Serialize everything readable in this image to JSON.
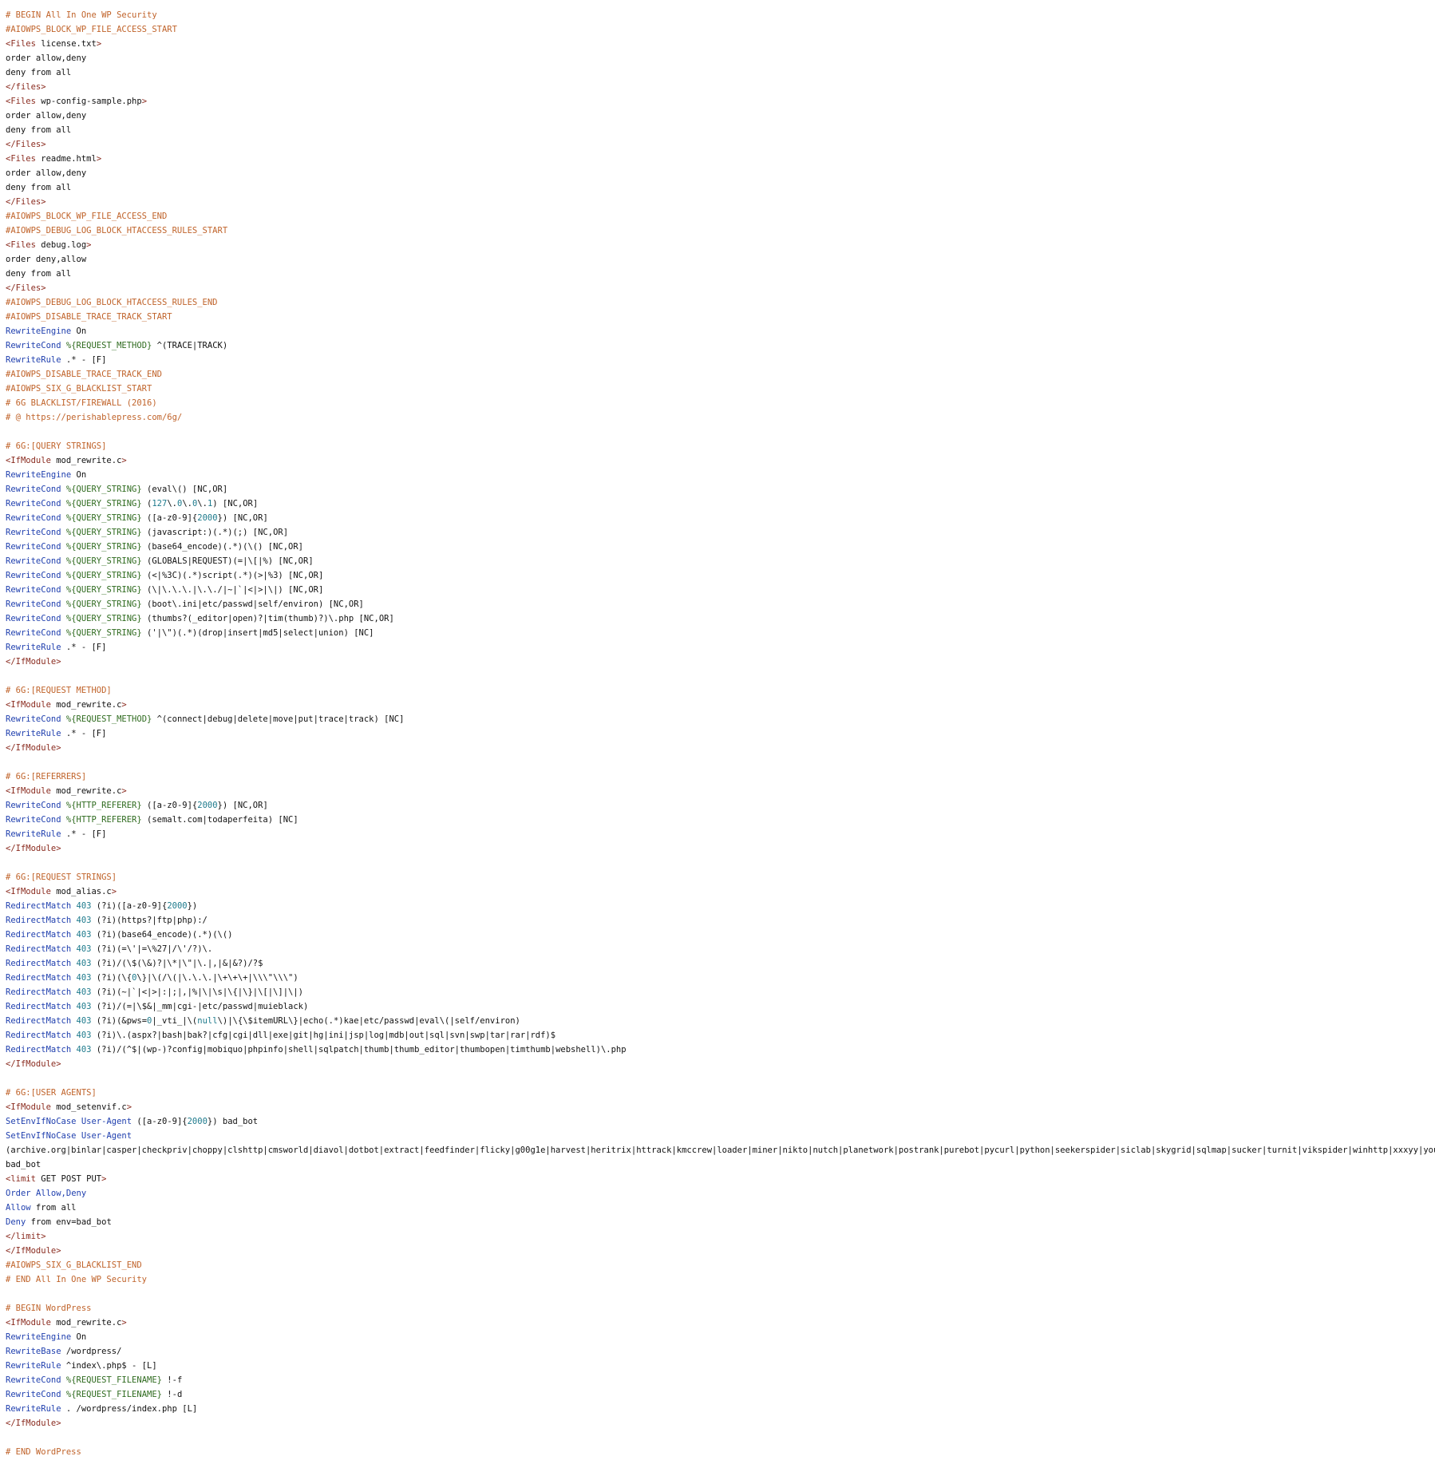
{
  "colors": {
    "background": "#ffffff",
    "comment": "#c0632a",
    "tag": "#8a2b1f",
    "directive": "#1f3fae",
    "variable": "#2f6b1f",
    "number": "#1d7a8c",
    "text": "#111111"
  },
  "lines": [
    [
      {
        "t": "comment",
        "s": "# BEGIN All In One WP Security"
      }
    ],
    [
      {
        "t": "comment",
        "s": "#AIOWPS_BLOCK_WP_FILE_ACCESS_START"
      }
    ],
    [
      {
        "t": "tag",
        "s": "<Files "
      },
      {
        "t": "text",
        "s": "license.txt"
      },
      {
        "t": "tag",
        "s": ">"
      }
    ],
    [
      {
        "t": "text",
        "s": "order allow,deny"
      }
    ],
    [
      {
        "t": "text",
        "s": "deny from all"
      }
    ],
    [
      {
        "t": "tag",
        "s": "</files>"
      }
    ],
    [
      {
        "t": "tag",
        "s": "<Files "
      },
      {
        "t": "text",
        "s": "wp-config-sample.php"
      },
      {
        "t": "tag",
        "s": ">"
      }
    ],
    [
      {
        "t": "text",
        "s": "order allow,deny"
      }
    ],
    [
      {
        "t": "text",
        "s": "deny from all"
      }
    ],
    [
      {
        "t": "tag",
        "s": "</Files>"
      }
    ],
    [
      {
        "t": "tag",
        "s": "<Files "
      },
      {
        "t": "text",
        "s": "readme.html"
      },
      {
        "t": "tag",
        "s": ">"
      }
    ],
    [
      {
        "t": "text",
        "s": "order allow,deny"
      }
    ],
    [
      {
        "t": "text",
        "s": "deny from all"
      }
    ],
    [
      {
        "t": "tag",
        "s": "</Files>"
      }
    ],
    [
      {
        "t": "comment",
        "s": "#AIOWPS_BLOCK_WP_FILE_ACCESS_END"
      }
    ],
    [
      {
        "t": "comment",
        "s": "#AIOWPS_DEBUG_LOG_BLOCK_HTACCESS_RULES_START"
      }
    ],
    [
      {
        "t": "tag",
        "s": "<Files "
      },
      {
        "t": "text",
        "s": "debug.log"
      },
      {
        "t": "tag",
        "s": ">"
      }
    ],
    [
      {
        "t": "text",
        "s": "order deny,allow"
      }
    ],
    [
      {
        "t": "text",
        "s": "deny from all"
      }
    ],
    [
      {
        "t": "tag",
        "s": "</Files>"
      }
    ],
    [
      {
        "t": "comment",
        "s": "#AIOWPS_DEBUG_LOG_BLOCK_HTACCESS_RULES_END"
      }
    ],
    [
      {
        "t": "comment",
        "s": "#AIOWPS_DISABLE_TRACE_TRACK_START"
      }
    ],
    [
      {
        "t": "directive",
        "s": "RewriteEngine"
      },
      {
        "t": "text",
        "s": " On"
      }
    ],
    [
      {
        "t": "directive",
        "s": "RewriteCond"
      },
      {
        "t": "text",
        "s": " "
      },
      {
        "t": "var",
        "s": "%{REQUEST_METHOD}"
      },
      {
        "t": "text",
        "s": " ^(TRACE|TRACK)"
      }
    ],
    [
      {
        "t": "directive",
        "s": "RewriteRule"
      },
      {
        "t": "text",
        "s": " .* - [F]"
      }
    ],
    [
      {
        "t": "comment",
        "s": "#AIOWPS_DISABLE_TRACE_TRACK_END"
      }
    ],
    [
      {
        "t": "comment",
        "s": "#AIOWPS_SIX_G_BLACKLIST_START"
      }
    ],
    [
      {
        "t": "comment",
        "s": "# 6G BLACKLIST/FIREWALL (2016)"
      }
    ],
    [
      {
        "t": "comment",
        "s": "# @ https://perishablepress.com/6g/"
      }
    ],
    [],
    [
      {
        "t": "comment",
        "s": "# 6G:[QUERY STRINGS]"
      }
    ],
    [
      {
        "t": "tag",
        "s": "<IfModule "
      },
      {
        "t": "text",
        "s": "mod_rewrite.c"
      },
      {
        "t": "tag",
        "s": ">"
      }
    ],
    [
      {
        "t": "directive",
        "s": "RewriteEngine"
      },
      {
        "t": "text",
        "s": " On"
      }
    ],
    [
      {
        "t": "directive",
        "s": "RewriteCond"
      },
      {
        "t": "text",
        "s": " "
      },
      {
        "t": "var",
        "s": "%{QUERY_STRING}"
      },
      {
        "t": "text",
        "s": " (eval\\() [NC,OR]"
      }
    ],
    [
      {
        "t": "directive",
        "s": "RewriteCond"
      },
      {
        "t": "text",
        "s": " "
      },
      {
        "t": "var",
        "s": "%{QUERY_STRING}"
      },
      {
        "t": "text",
        "s": " ("
      },
      {
        "t": "num",
        "s": "127"
      },
      {
        "t": "text",
        "s": "\\."
      },
      {
        "t": "num",
        "s": "0"
      },
      {
        "t": "text",
        "s": "\\."
      },
      {
        "t": "num",
        "s": "0"
      },
      {
        "t": "text",
        "s": "\\."
      },
      {
        "t": "num",
        "s": "1"
      },
      {
        "t": "text",
        "s": ") [NC,OR]"
      }
    ],
    [
      {
        "t": "directive",
        "s": "RewriteCond"
      },
      {
        "t": "text",
        "s": " "
      },
      {
        "t": "var",
        "s": "%{QUERY_STRING}"
      },
      {
        "t": "text",
        "s": " ([a-z0-9]{"
      },
      {
        "t": "num",
        "s": "2000"
      },
      {
        "t": "text",
        "s": "}) [NC,OR]"
      }
    ],
    [
      {
        "t": "directive",
        "s": "RewriteCond"
      },
      {
        "t": "text",
        "s": " "
      },
      {
        "t": "var",
        "s": "%{QUERY_STRING}"
      },
      {
        "t": "text",
        "s": " (javascript:)(.*)(;) [NC,OR]"
      }
    ],
    [
      {
        "t": "directive",
        "s": "RewriteCond"
      },
      {
        "t": "text",
        "s": " "
      },
      {
        "t": "var",
        "s": "%{QUERY_STRING}"
      },
      {
        "t": "text",
        "s": " (base64_encode)(.*)(\\() [NC,OR]"
      }
    ],
    [
      {
        "t": "directive",
        "s": "RewriteCond"
      },
      {
        "t": "text",
        "s": " "
      },
      {
        "t": "var",
        "s": "%{QUERY_STRING}"
      },
      {
        "t": "text",
        "s": " (GLOBALS|REQUEST)(=|\\[|%) [NC,OR]"
      }
    ],
    [
      {
        "t": "directive",
        "s": "RewriteCond"
      },
      {
        "t": "text",
        "s": " "
      },
      {
        "t": "var",
        "s": "%{QUERY_STRING}"
      },
      {
        "t": "text",
        "s": " (<|%3C)(.*)script(.*)(>|%3) [NC,OR]"
      }
    ],
    [
      {
        "t": "directive",
        "s": "RewriteCond"
      },
      {
        "t": "text",
        "s": " "
      },
      {
        "t": "var",
        "s": "%{QUERY_STRING}"
      },
      {
        "t": "text",
        "s": " (\\|\\.\\.\\.|\\.\\./|~|`|<|>|\\|) [NC,OR]"
      }
    ],
    [
      {
        "t": "directive",
        "s": "RewriteCond"
      },
      {
        "t": "text",
        "s": " "
      },
      {
        "t": "var",
        "s": "%{QUERY_STRING}"
      },
      {
        "t": "text",
        "s": " (boot\\.ini|etc/passwd|self/environ) [NC,OR]"
      }
    ],
    [
      {
        "t": "directive",
        "s": "RewriteCond"
      },
      {
        "t": "text",
        "s": " "
      },
      {
        "t": "var",
        "s": "%{QUERY_STRING}"
      },
      {
        "t": "text",
        "s": " (thumbs?(_editor|open)?|tim(thumb)?)\\.php [NC,OR]"
      }
    ],
    [
      {
        "t": "directive",
        "s": "RewriteCond"
      },
      {
        "t": "text",
        "s": " "
      },
      {
        "t": "var",
        "s": "%{QUERY_STRING}"
      },
      {
        "t": "text",
        "s": " ('|\\\")(.*)(drop|insert|md5|select|union) [NC]"
      }
    ],
    [
      {
        "t": "directive",
        "s": "RewriteRule"
      },
      {
        "t": "text",
        "s": " .* - [F]"
      }
    ],
    [
      {
        "t": "tag",
        "s": "</IfModule>"
      }
    ],
    [],
    [
      {
        "t": "comment",
        "s": "# 6G:[REQUEST METHOD]"
      }
    ],
    [
      {
        "t": "tag",
        "s": "<IfModule "
      },
      {
        "t": "text",
        "s": "mod_rewrite.c"
      },
      {
        "t": "tag",
        "s": ">"
      }
    ],
    [
      {
        "t": "directive",
        "s": "RewriteCond"
      },
      {
        "t": "text",
        "s": " "
      },
      {
        "t": "var",
        "s": "%{REQUEST_METHOD}"
      },
      {
        "t": "text",
        "s": " ^(connect|debug|delete|move|put|trace|track) [NC]"
      }
    ],
    [
      {
        "t": "directive",
        "s": "RewriteRule"
      },
      {
        "t": "text",
        "s": " .* - [F]"
      }
    ],
    [
      {
        "t": "tag",
        "s": "</IfModule>"
      }
    ],
    [],
    [
      {
        "t": "comment",
        "s": "# 6G:[REFERRERS]"
      }
    ],
    [
      {
        "t": "tag",
        "s": "<IfModule "
      },
      {
        "t": "text",
        "s": "mod_rewrite.c"
      },
      {
        "t": "tag",
        "s": ">"
      }
    ],
    [
      {
        "t": "directive",
        "s": "RewriteCond"
      },
      {
        "t": "text",
        "s": " "
      },
      {
        "t": "var",
        "s": "%{HTTP_REFERER}"
      },
      {
        "t": "text",
        "s": " ([a-z0-9]{"
      },
      {
        "t": "num",
        "s": "2000"
      },
      {
        "t": "text",
        "s": "}) [NC,OR]"
      }
    ],
    [
      {
        "t": "directive",
        "s": "RewriteCond"
      },
      {
        "t": "text",
        "s": " "
      },
      {
        "t": "var",
        "s": "%{HTTP_REFERER}"
      },
      {
        "t": "text",
        "s": " (semalt.com|todaperfeita) [NC]"
      }
    ],
    [
      {
        "t": "directive",
        "s": "RewriteRule"
      },
      {
        "t": "text",
        "s": " .* - [F]"
      }
    ],
    [
      {
        "t": "tag",
        "s": "</IfModule>"
      }
    ],
    [],
    [
      {
        "t": "comment",
        "s": "# 6G:[REQUEST STRINGS]"
      }
    ],
    [
      {
        "t": "tag",
        "s": "<IfModule "
      },
      {
        "t": "text",
        "s": "mod_alias.c"
      },
      {
        "t": "tag",
        "s": ">"
      }
    ],
    [
      {
        "t": "directive",
        "s": "RedirectMatch"
      },
      {
        "t": "text",
        "s": " "
      },
      {
        "t": "num",
        "s": "403"
      },
      {
        "t": "text",
        "s": " (?i)([a-z0-9]{"
      },
      {
        "t": "num",
        "s": "2000"
      },
      {
        "t": "text",
        "s": "})"
      }
    ],
    [
      {
        "t": "directive",
        "s": "RedirectMatch"
      },
      {
        "t": "text",
        "s": " "
      },
      {
        "t": "num",
        "s": "403"
      },
      {
        "t": "text",
        "s": " (?i)(https?|ftp|php):/"
      }
    ],
    [
      {
        "t": "directive",
        "s": "RedirectMatch"
      },
      {
        "t": "text",
        "s": " "
      },
      {
        "t": "num",
        "s": "403"
      },
      {
        "t": "text",
        "s": " (?i)(base64_encode)(.*)(\\()"
      }
    ],
    [
      {
        "t": "directive",
        "s": "RedirectMatch"
      },
      {
        "t": "text",
        "s": " "
      },
      {
        "t": "num",
        "s": "403"
      },
      {
        "t": "text",
        "s": " (?i)(=\\'|=\\%27|/\\'/?)\\."
      }
    ],
    [
      {
        "t": "directive",
        "s": "RedirectMatch"
      },
      {
        "t": "text",
        "s": " "
      },
      {
        "t": "num",
        "s": "403"
      },
      {
        "t": "text",
        "s": " (?i)/(\\$(\\&)?|\\*|\\\"|\\.|,|&|&?)/?$"
      }
    ],
    [
      {
        "t": "directive",
        "s": "RedirectMatch"
      },
      {
        "t": "text",
        "s": " "
      },
      {
        "t": "num",
        "s": "403"
      },
      {
        "t": "text",
        "s": " (?i)(\\{"
      },
      {
        "t": "num",
        "s": "0"
      },
      {
        "t": "text",
        "s": "\\}|\\(/\\(|\\.\\.\\.|\\+\\+\\+|\\\\\\\"\\\\\\\")"
      }
    ],
    [
      {
        "t": "directive",
        "s": "RedirectMatch"
      },
      {
        "t": "text",
        "s": " "
      },
      {
        "t": "num",
        "s": "403"
      },
      {
        "t": "text",
        "s": " (?i)(~|`|<|>|:|;|,|%|\\|\\s|\\{|\\}|\\[|\\]|\\|)"
      }
    ],
    [
      {
        "t": "directive",
        "s": "RedirectMatch"
      },
      {
        "t": "text",
        "s": " "
      },
      {
        "t": "num",
        "s": "403"
      },
      {
        "t": "text",
        "s": " (?i)/(=|\\$&|_mm|cgi-|etc/passwd|muieblack)"
      }
    ],
    [
      {
        "t": "directive",
        "s": "RedirectMatch"
      },
      {
        "t": "text",
        "s": " "
      },
      {
        "t": "num",
        "s": "403"
      },
      {
        "t": "text",
        "s": " (?i)(&pws="
      },
      {
        "t": "num",
        "s": "0"
      },
      {
        "t": "text",
        "s": "|_vti_|\\("
      },
      {
        "t": "num",
        "s": "null"
      },
      {
        "t": "text",
        "s": "\\)|\\{\\$itemURL\\}|echo(.*)kae|etc/passwd|eval\\(|self/environ)"
      }
    ],
    [
      {
        "t": "directive",
        "s": "RedirectMatch"
      },
      {
        "t": "text",
        "s": " "
      },
      {
        "t": "num",
        "s": "403"
      },
      {
        "t": "text",
        "s": " (?i)\\.(aspx?|bash|bak?|cfg|cgi|dll|exe|git|hg|ini|jsp|log|mdb|out|sql|svn|swp|tar|rar|rdf)$"
      }
    ],
    [
      {
        "t": "directive",
        "s": "RedirectMatch"
      },
      {
        "t": "text",
        "s": " "
      },
      {
        "t": "num",
        "s": "403"
      },
      {
        "t": "text",
        "s": " (?i)/(^$|(wp-)?config|mobiquo|phpinfo|shell|sqlpatch|thumb|thumb_editor|thumbopen|timthumb|webshell)\\.php"
      }
    ],
    [
      {
        "t": "tag",
        "s": "</IfModule>"
      }
    ],
    [],
    [
      {
        "t": "comment",
        "s": "# 6G:[USER AGENTS]"
      }
    ],
    [
      {
        "t": "tag",
        "s": "<IfModule "
      },
      {
        "t": "text",
        "s": "mod_setenvif.c"
      },
      {
        "t": "tag",
        "s": ">"
      }
    ],
    [
      {
        "t": "directive",
        "s": "SetEnvIfNoCase"
      },
      {
        "t": "text",
        "s": " "
      },
      {
        "t": "directive",
        "s": "User-Agent"
      },
      {
        "t": "text",
        "s": " ([a-z0-9]{"
      },
      {
        "t": "num",
        "s": "2000"
      },
      {
        "t": "text",
        "s": "}) bad_bot"
      }
    ],
    [
      {
        "t": "directive",
        "s": "SetEnvIfNoCase"
      },
      {
        "t": "text",
        "s": " "
      },
      {
        "t": "directive",
        "s": "User-Agent"
      }
    ],
    [
      {
        "t": "text",
        "s": "(archive.org|binlar|casper|checkpriv|choppy|clshttp|cmsworld|diavol|dotbot|extract|feedfinder|flicky|g00g1e|harvest|heritrix|httrack|kmccrew|loader|miner|nikto|nutch|planetwork|postrank|purebot|pycurl|python|seekerspider|siclab|skygrid|sqlmap|sucker|turnit|vikspider|winhttp|xxxyy|youda|zmeu|zune)"
      }
    ],
    [
      {
        "t": "text",
        "s": "bad_bot"
      }
    ],
    [
      {
        "t": "tag",
        "s": "<limit "
      },
      {
        "t": "text",
        "s": "GET POST PUT"
      },
      {
        "t": "tag",
        "s": ">"
      }
    ],
    [
      {
        "t": "directive",
        "s": "Order"
      },
      {
        "t": "text",
        "s": " "
      },
      {
        "t": "directive",
        "s": "Allow,Deny"
      }
    ],
    [
      {
        "t": "directive",
        "s": "Allow"
      },
      {
        "t": "text",
        "s": " from all"
      }
    ],
    [
      {
        "t": "directive",
        "s": "Deny"
      },
      {
        "t": "text",
        "s": " from env=bad_bot"
      }
    ],
    [
      {
        "t": "tag",
        "s": "</limit>"
      }
    ],
    [
      {
        "t": "tag",
        "s": "</IfModule>"
      }
    ],
    [
      {
        "t": "comment",
        "s": "#AIOWPS_SIX_G_BLACKLIST_END"
      }
    ],
    [
      {
        "t": "comment",
        "s": "# END All In One WP Security"
      }
    ],
    [],
    [
      {
        "t": "comment",
        "s": "# BEGIN WordPress"
      }
    ],
    [
      {
        "t": "tag",
        "s": "<IfModule "
      },
      {
        "t": "text",
        "s": "mod_rewrite.c"
      },
      {
        "t": "tag",
        "s": ">"
      }
    ],
    [
      {
        "t": "directive",
        "s": "RewriteEngine"
      },
      {
        "t": "text",
        "s": " On"
      }
    ],
    [
      {
        "t": "directive",
        "s": "RewriteBase"
      },
      {
        "t": "text",
        "s": " /wordpress/"
      }
    ],
    [
      {
        "t": "directive",
        "s": "RewriteRule"
      },
      {
        "t": "text",
        "s": " ^index\\.php$ - [L]"
      }
    ],
    [
      {
        "t": "directive",
        "s": "RewriteCond"
      },
      {
        "t": "text",
        "s": " "
      },
      {
        "t": "var",
        "s": "%{REQUEST_FILENAME}"
      },
      {
        "t": "text",
        "s": " !-f"
      }
    ],
    [
      {
        "t": "directive",
        "s": "RewriteCond"
      },
      {
        "t": "text",
        "s": " "
      },
      {
        "t": "var",
        "s": "%{REQUEST_FILENAME}"
      },
      {
        "t": "text",
        "s": " !-d"
      }
    ],
    [
      {
        "t": "directive",
        "s": "RewriteRule"
      },
      {
        "t": "text",
        "s": " . /wordpress/index.php [L]"
      }
    ],
    [
      {
        "t": "tag",
        "s": "</IfModule>"
      }
    ],
    [],
    [
      {
        "t": "comment",
        "s": "# END WordPress"
      }
    ]
  ]
}
